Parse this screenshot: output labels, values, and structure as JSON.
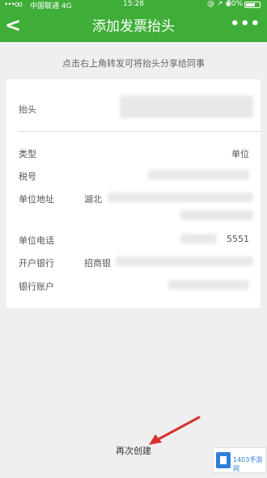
{
  "status": {
    "signal": "•••oo",
    "carrier": "中国联通 4G",
    "time": "15:28",
    "icons": "@ ↗ ◉",
    "battery": "70%",
    "battery_level": 0.7
  },
  "nav": {
    "back_glyph": "<",
    "title": "添加发票抬头",
    "more_glyph": "•••"
  },
  "hint": "点击右上角转发可将抬头分享给同事",
  "form": {
    "header_label": "抬头",
    "type_label": "类型",
    "type_value": "单位",
    "tax_label": "税号",
    "address_label": "单位地址",
    "address_value": "湖北",
    "phone_label": "单位电话",
    "phone_value": "5551",
    "bank_label": "开户银行",
    "bank_value": "招商银",
    "account_label": "银行账户"
  },
  "recreate_label": "再次创建",
  "watermark": "1403手游网",
  "colors": {
    "accent": "#3fae39",
    "arrow": "#d9322d"
  }
}
